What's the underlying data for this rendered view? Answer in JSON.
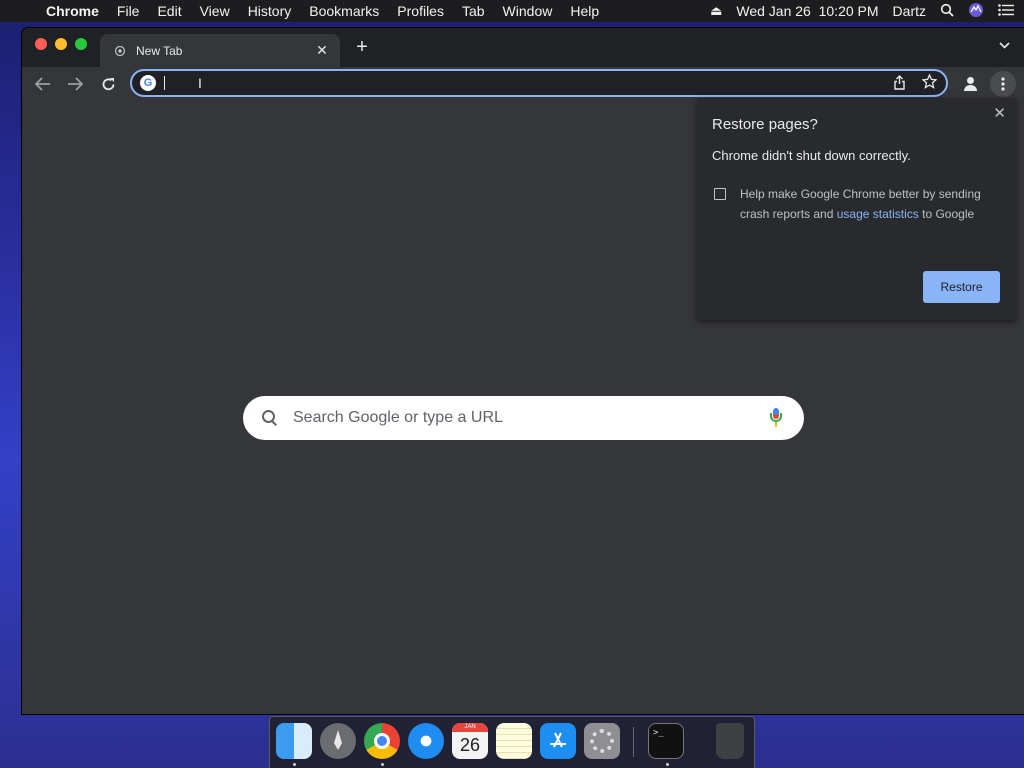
{
  "menubar": {
    "app": "Chrome",
    "items": [
      "File",
      "Edit",
      "View",
      "History",
      "Bookmarks",
      "Profiles",
      "Tab",
      "Window",
      "Help"
    ],
    "datetime": "Wed Jan 26  10:20 PM",
    "user": "Dartz"
  },
  "tab": {
    "title": "New Tab"
  },
  "omnibox": {
    "value": ""
  },
  "search": {
    "placeholder": "Search Google or type a URL"
  },
  "restore_popup": {
    "title": "Restore pages?",
    "message": "Chrome didn't shut down correctly.",
    "checkbox_text": "Help make Google Chrome better by sending crash reports and",
    "link_text": "usage statistics",
    "checkbox_text_after": "to Google",
    "checkbox_checked": false,
    "button_label": "Restore"
  },
  "dock": {
    "calendar_month": "JAN",
    "calendar_day": "26",
    "items": [
      "Finder",
      "Launchpad",
      "Google Chrome",
      "Safari",
      "Calendar",
      "Notes",
      "App Store",
      "System Preferences",
      "Terminal",
      "Trash"
    ]
  },
  "colors": {
    "accent": "#8ab4f8",
    "background": "#35363a"
  }
}
